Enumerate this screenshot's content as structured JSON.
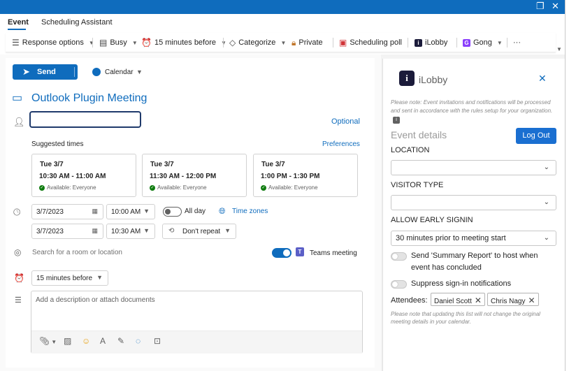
{
  "window": {
    "restore_glyph": "❐",
    "close_glyph": "✕"
  },
  "tabs": [
    {
      "label": "Event"
    },
    {
      "label": "Scheduling Assistant"
    }
  ],
  "ribbon": {
    "response_options": "Response options",
    "busy": "Busy",
    "reminder": "15 minutes before",
    "categorize": "Categorize",
    "private": "Private",
    "scheduling_poll": "Scheduling poll",
    "ilobby": "iLobby",
    "gong": "Gong",
    "more": "···"
  },
  "compose": {
    "send_label": "Send",
    "calendar_label": "Calendar",
    "title": "Outlook Plugin Meeting",
    "optional_link": "Optional",
    "suggested_label": "Suggested times",
    "preferences_link": "Preferences",
    "suggested_times": [
      {
        "day": "Tue 3/7",
        "time": "10:30 AM - 11:00 AM",
        "availability": "Available: Everyone"
      },
      {
        "day": "Tue 3/7",
        "time": "11:30 AM - 12:00 PM",
        "availability": "Available: Everyone"
      },
      {
        "day": "Tue 3/7",
        "time": "1:00 PM - 1:30 PM",
        "availability": "Available: Everyone"
      }
    ],
    "start_date": "3/7/2023",
    "start_time": "10:00 AM",
    "end_date": "3/7/2023",
    "end_time": "10:30 AM",
    "all_day_label": "All day",
    "all_day_on": false,
    "time_zones_link": "Time zones",
    "repeat_label": "Don't repeat",
    "location_placeholder": "Search for a room or location",
    "teams_meeting_label": "Teams meeting",
    "teams_meeting_on": true,
    "reminder_value": "15 minutes before",
    "description_placeholder": "Add a description or attach documents"
  },
  "ilobby_panel": {
    "title": "iLobby",
    "note": "Please note: Event invitations and notifications will be processed and sent in accordance with the rules setup for your organization.",
    "event_details": "Event details",
    "logout_label": "Log Out",
    "location_label": "LOCATION",
    "location_value": "",
    "visitor_type_label": "VISITOR TYPE",
    "visitor_type_value": "",
    "early_signin_label": "ALLOW EARLY SIGNIN",
    "early_signin_value": "30 minutes prior to meeting start",
    "summary_report_label": "Send 'Summary Report' to host when event has concluded",
    "summary_report_on": false,
    "suppress_label": "Suppress sign-in notifications",
    "suppress_on": false,
    "attendees_label": "Attendees:",
    "attendees": [
      {
        "name": "Daniel Scott"
      },
      {
        "name": "Chris Nagy"
      }
    ],
    "attendees_note": "Please note that updating this list will not change the original meeting details in your calendar."
  },
  "colors": {
    "accent": "#0f6cbd",
    "ilobby_button": "#1a6fd1",
    "teams": "#5b5fc7",
    "available": "#107c10"
  }
}
